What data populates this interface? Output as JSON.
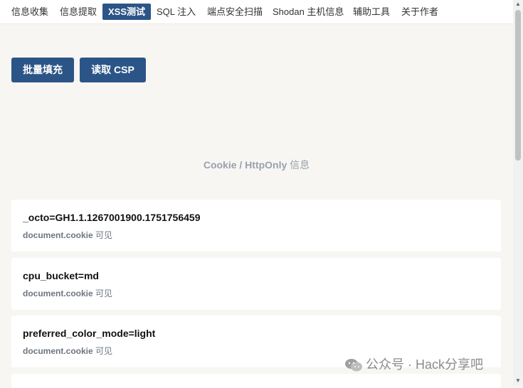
{
  "nav": {
    "tabs": [
      {
        "label": "信息收集"
      },
      {
        "label": "信息提取"
      },
      {
        "label": "XSS测试"
      },
      {
        "label": "SQL 注入"
      },
      {
        "label": "端点安全扫描"
      },
      {
        "label": "Shodan 主机信息"
      },
      {
        "label": "辅助工具"
      },
      {
        "label": "关于作者"
      }
    ],
    "active_tab": "XSS测试"
  },
  "actions": {
    "batch_fill_label": "批量填充",
    "read_csp_label": "读取 CSP"
  },
  "cookie_section": {
    "title_strong": "Cookie / HttpOnly",
    "title_rest": "信息",
    "items": [
      {
        "name": "_octo=GH1.1.1267001900.1751756459",
        "source": "document.cookie",
        "status": "可见"
      },
      {
        "name": "cpu_bucket=md",
        "source": "document.cookie",
        "status": "可见"
      },
      {
        "name": "preferred_color_mode=light",
        "source": "document.cookie",
        "status": "可见"
      }
    ]
  },
  "watermark": {
    "text": "公众号 · Hack分享吧",
    "icon": "wechat-icon"
  },
  "colors": {
    "accent": "#2c5587",
    "background": "#f7f6f3",
    "card": "#ffffff",
    "muted_text": "#9aa1ad"
  }
}
